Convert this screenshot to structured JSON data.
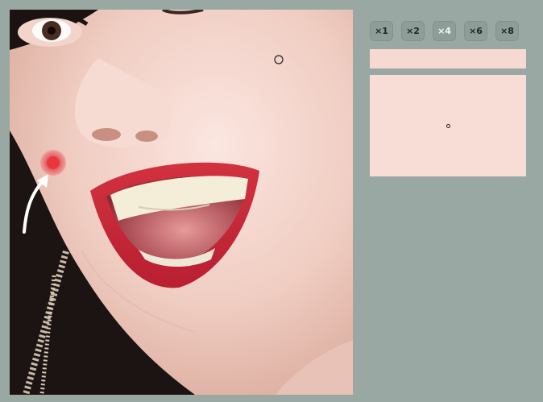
{
  "zoom_options": [
    {
      "label": "×1",
      "active": false
    },
    {
      "label": "×2",
      "active": false
    },
    {
      "label": "×4",
      "active": true
    },
    {
      "label": "×6",
      "active": false
    },
    {
      "label": "×8",
      "active": false
    }
  ],
  "colors": {
    "background": "#9aa8a3",
    "picked_color": "#f6d9d2",
    "magnified_color": "#f8dcd6",
    "active_zoom_text": "#f3f6f5"
  }
}
